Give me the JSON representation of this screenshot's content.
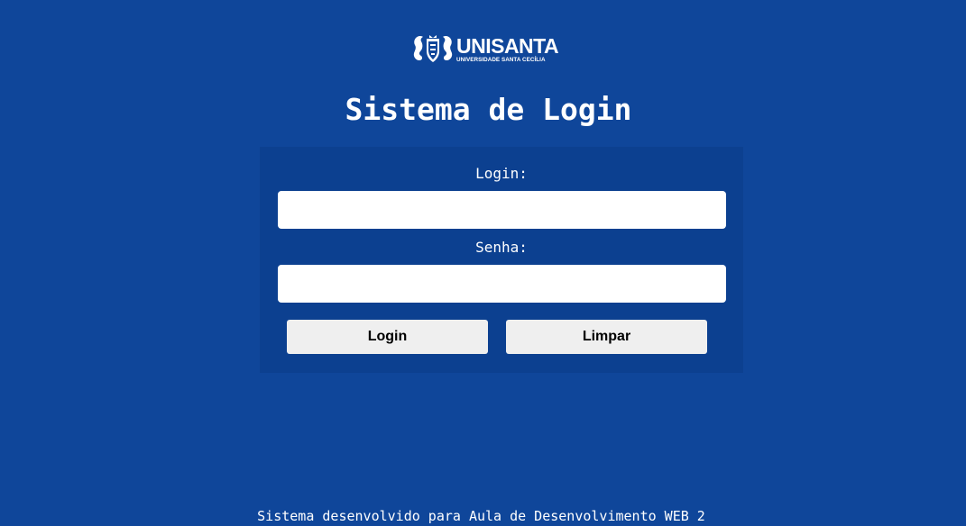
{
  "logo": {
    "name": "UNISANTA",
    "subtitle": "UNIVERSIDADE SANTA CECÍLIA",
    "icon": "seahorse-crest-icon"
  },
  "page": {
    "title": "Sistema de Login"
  },
  "form": {
    "login_label": "Login:",
    "login_value": "",
    "senha_label": "Senha:",
    "senha_value": "",
    "login_button": "Login",
    "clear_button": "Limpar"
  },
  "footer": {
    "text": "Sistema desenvolvido para Aula de Desenvolvimento WEB 2"
  },
  "colors": {
    "background": "#0f469a",
    "panel": "#0c4090",
    "button": "#efefef"
  }
}
